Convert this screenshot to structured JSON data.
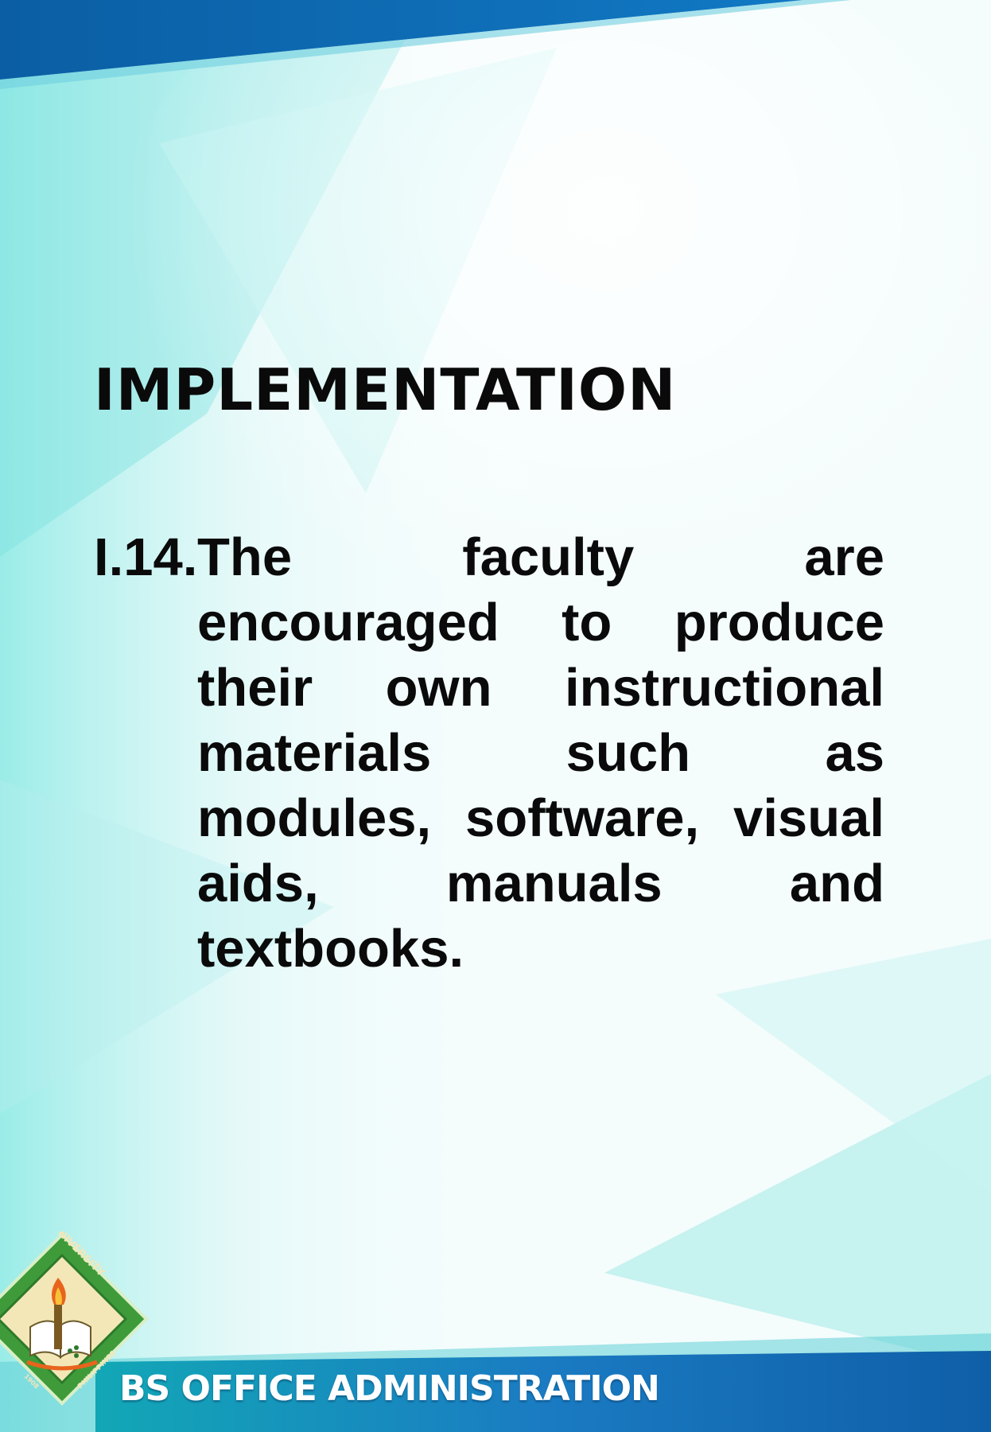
{
  "slide": {
    "heading": "IMPLEMENTATION",
    "item_number": "I.14.",
    "item_text": "The faculty are encouraged to produce their own instructional materials such as modules, software, visual aids, manuals and textbooks."
  },
  "footer": {
    "title": "BS OFFICE ADMINISTRATION",
    "seal_text": [
      "UNIVERSITY",
      "PHILIPPINES",
      "1908"
    ]
  },
  "colors": {
    "top_band": "#0d6fb5",
    "bottom_band": "#1366b0",
    "seal_green": "#3f9b3a",
    "aqua": "#86e8e4"
  }
}
